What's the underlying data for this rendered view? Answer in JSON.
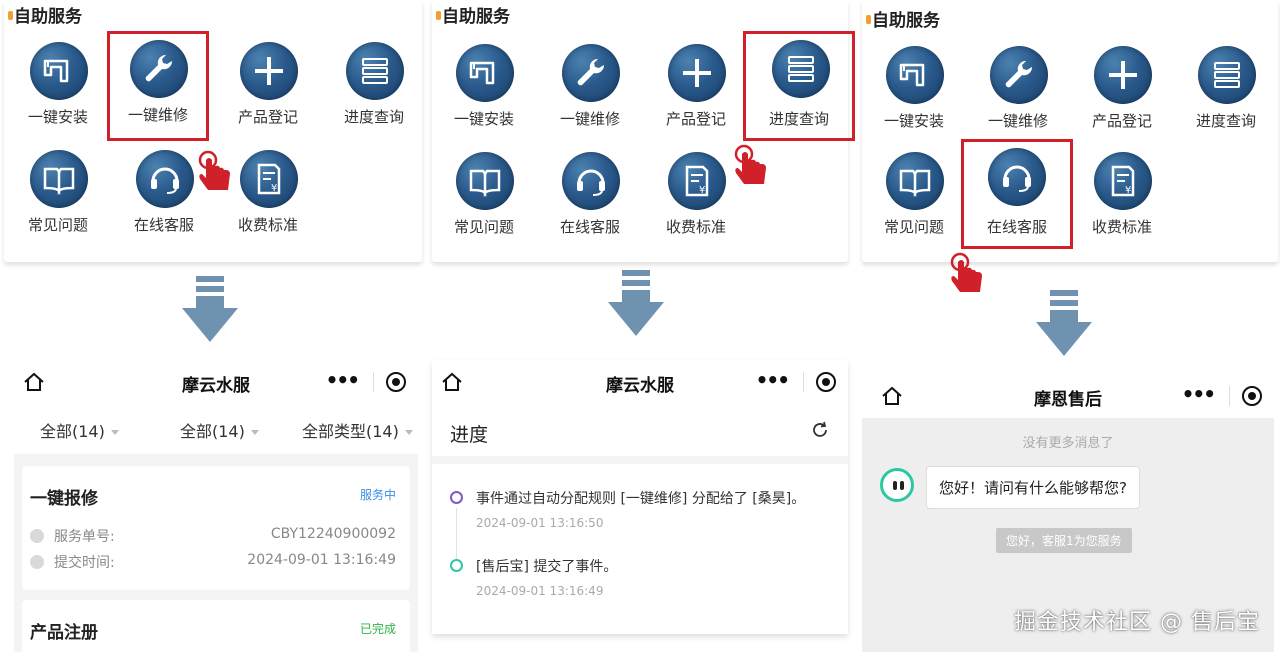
{
  "panels": [
    {
      "section_title": "自助服务",
      "items": [
        {
          "label": "一键安装",
          "icon": "pipe-icon"
        },
        {
          "label": "一键维修",
          "icon": "wrench-icon"
        },
        {
          "label": "产品登记",
          "icon": "plus-icon"
        },
        {
          "label": "进度查询",
          "icon": "list-icon"
        },
        {
          "label": "常见问题",
          "icon": "book-icon"
        },
        {
          "label": "在线客服",
          "icon": "headset-icon"
        },
        {
          "label": "收费标准",
          "icon": "fee-doc-icon"
        }
      ],
      "highlighted": "一键维修"
    },
    {
      "section_title": "自助服务",
      "items": [
        {
          "label": "一键安装",
          "icon": "pipe-icon"
        },
        {
          "label": "一键维修",
          "icon": "wrench-icon"
        },
        {
          "label": "产品登记",
          "icon": "plus-icon"
        },
        {
          "label": "进度查询",
          "icon": "list-icon"
        },
        {
          "label": "常见问题",
          "icon": "book-icon"
        },
        {
          "label": "在线客服",
          "icon": "headset-icon"
        },
        {
          "label": "收费标准",
          "icon": "fee-doc-icon"
        }
      ],
      "highlighted": "进度查询"
    },
    {
      "section_title": "自助服务",
      "items": [
        {
          "label": "一键安装",
          "icon": "pipe-icon"
        },
        {
          "label": "一键维修",
          "icon": "wrench-icon"
        },
        {
          "label": "产品登记",
          "icon": "plus-icon"
        },
        {
          "label": "进度查询",
          "icon": "list-icon"
        },
        {
          "label": "常见问题",
          "icon": "book-icon"
        },
        {
          "label": "在线客服",
          "icon": "headset-icon"
        },
        {
          "label": "收费标准",
          "icon": "fee-doc-icon"
        }
      ],
      "highlighted": "在线客服"
    }
  ],
  "screen_orders": {
    "title": "摩云水服",
    "more": "•••",
    "filters": [
      "全部(14)",
      "全部(14)",
      "全部类型(14)"
    ],
    "orders": [
      {
        "title": "一键报修",
        "status": "服务中",
        "status_color": "#3a8ee6",
        "rows": [
          {
            "label": "服务单号:",
            "value": "CBY12240900092"
          },
          {
            "label": "提交时间:",
            "value": "2024-09-01 13:16:49"
          }
        ]
      },
      {
        "title": "产品注册",
        "status": "已完成",
        "status_color": "#2fb344",
        "rows": []
      }
    ]
  },
  "screen_progress": {
    "title": "摩云水服",
    "more": "•••",
    "heading": "进度",
    "events": [
      {
        "text": "事件通过自动分配规则 [一键维修] 分配给了 [桑昊]。",
        "time": "2024-09-01 13:16:50",
        "color": "#7b5cc7"
      },
      {
        "text": "[售后宝] 提交了事件。",
        "time": "2024-09-01 13:16:49",
        "color": "#2bc8a4"
      }
    ]
  },
  "screen_chat": {
    "title": "摩恩售后",
    "more": "•••",
    "no_more": "没有更多消息了",
    "message": "您好！请问有什么能够帮您?",
    "system_tip": "您好，客服1为您服务"
  },
  "watermark": "掘金技术社区 @ 售后宝",
  "colors": {
    "highlight": "#d0202a",
    "icon_bg": "#2a5a8c",
    "arrow": "#6e92b0"
  }
}
